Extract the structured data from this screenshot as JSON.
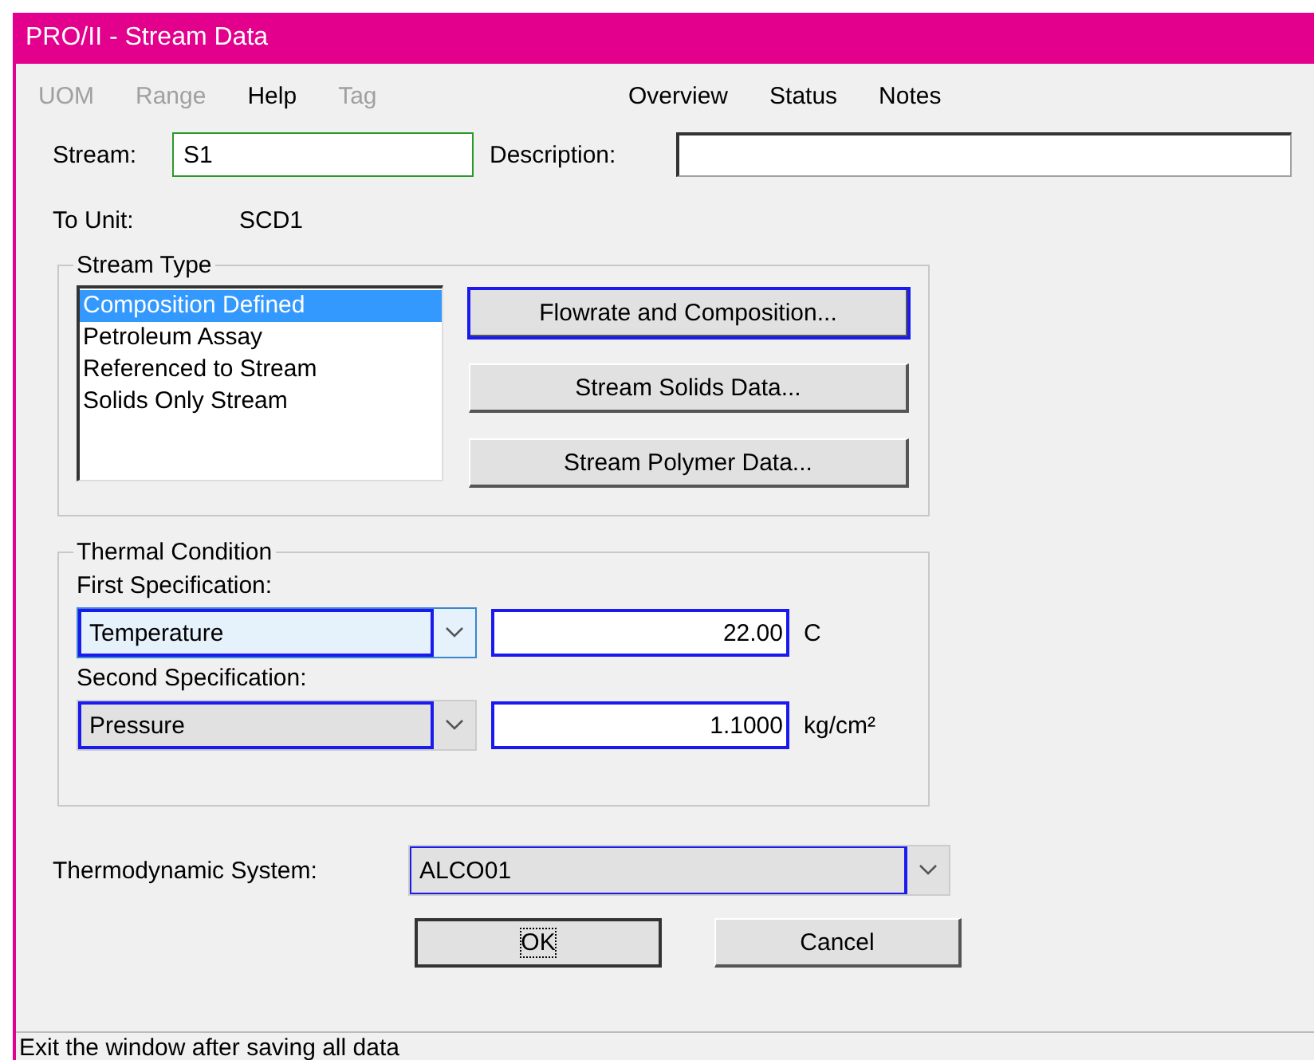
{
  "window": {
    "title": "PRO/II - Stream Data"
  },
  "menu": [
    {
      "label": "UOM",
      "disabled": true
    },
    {
      "label": "Range",
      "disabled": true
    },
    {
      "label": "Help",
      "disabled": false
    },
    {
      "label": "Tag",
      "disabled": true
    }
  ],
  "view_menu": [
    "Overview",
    "Status",
    "Notes"
  ],
  "stream": {
    "label": "Stream:",
    "value": "S1"
  },
  "description": {
    "label": "Description:"
  },
  "to_unit": {
    "label": "To Unit:",
    "value": "SCD1"
  },
  "stream_type": {
    "title": "Stream Type",
    "options": [
      {
        "label": "Composition Defined",
        "selected": true
      },
      {
        "label": "Petroleum Assay",
        "selected": false
      },
      {
        "label": "Referenced to Stream",
        "selected": false
      },
      {
        "label": "Solids Only Stream",
        "selected": false
      }
    ],
    "buttons": [
      {
        "label": "Flowrate and Composition...",
        "focused": true
      },
      {
        "label": "Stream Solids Data...",
        "focused": false
      },
      {
        "label": "Stream Polymer Data...",
        "focused": false
      }
    ]
  },
  "thermal_condition": {
    "title": "Thermal Condition",
    "specs": [
      {
        "label": "First Specification:",
        "parameter": "Temperature",
        "value": "22.00",
        "unit": "C",
        "focused": true
      },
      {
        "label": "Second Specification:",
        "parameter": "Pressure",
        "value": "1.1000",
        "unit": "kg/cm²",
        "focused": false
      }
    ]
  },
  "thermodynamic_system": {
    "label": "Thermodynamic System:",
    "value": "ALCO01"
  },
  "buttons": [
    {
      "label": "OK",
      "default": true
    },
    {
      "label": "Cancel",
      "default": false
    }
  ],
  "status_bar": "Exit the window after saving all data"
}
